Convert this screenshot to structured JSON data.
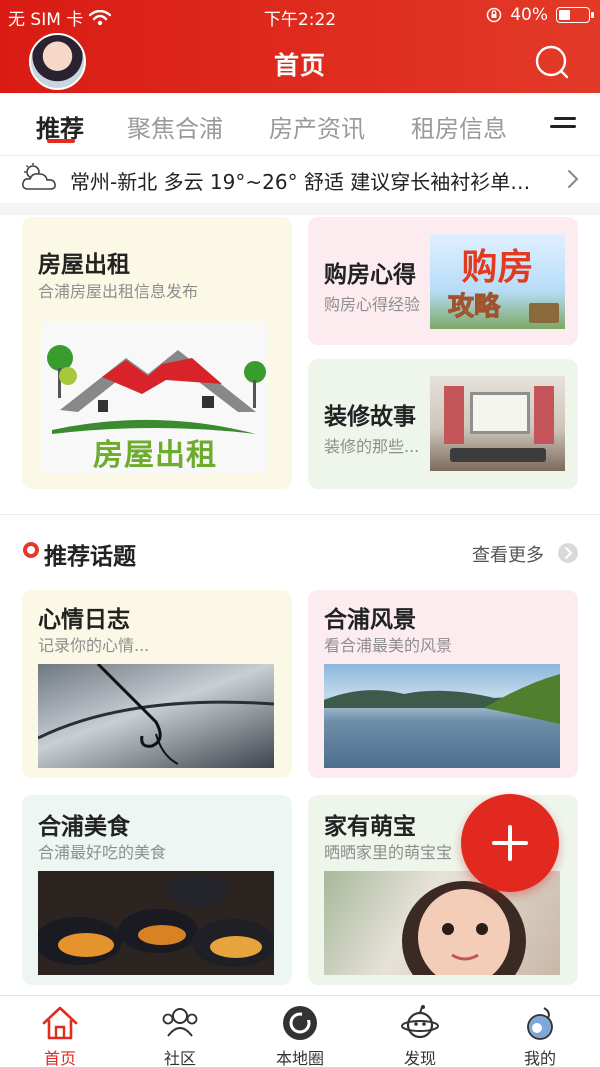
{
  "status_bar": {
    "carrier": "无 SIM 卡",
    "time": "下午2:22",
    "battery": "40%",
    "battery_level": 0.4
  },
  "header": {
    "title": "首页",
    "avatar_icon": "user-avatar",
    "search_icon": "search-icon",
    "color": "#dd2a1e"
  },
  "tabs": [
    {
      "label": "推荐",
      "active": true
    },
    {
      "label": "聚焦合浦",
      "active": false
    },
    {
      "label": "房产资讯",
      "active": false
    },
    {
      "label": "租房信息",
      "active": false
    }
  ],
  "weather": {
    "icon": "cloudy-icon",
    "text": "常州-新北 多云 19°~26° 舒适 建议穿长袖衬衫单…"
  },
  "feature_cards": {
    "rental": {
      "title": "房屋出租",
      "subtitle": "合浦房屋出租信息发布",
      "image_text": "房屋出租"
    },
    "buy": {
      "title": "购房心得",
      "subtitle": "购房心得经验",
      "image_text_1": "购房",
      "image_text_2": "攻略"
    },
    "decoration": {
      "title": "装修故事",
      "subtitle": "装修的那些..."
    }
  },
  "recommended_topics": {
    "title": "推荐话题",
    "more_label": "查看更多",
    "items": [
      {
        "title": "心情日志",
        "subtitle": "记录你的心情..."
      },
      {
        "title": "合浦风景",
        "subtitle": "看合浦最美的风景"
      },
      {
        "title": "合浦美食",
        "subtitle": "合浦最好吃的美食"
      },
      {
        "title": "家有萌宝",
        "subtitle": "晒晒家里的萌宝宝"
      }
    ]
  },
  "fab": {
    "icon": "plus-icon"
  },
  "bottom_nav": [
    {
      "label": "首页",
      "icon": "home-icon",
      "active": true
    },
    {
      "label": "社区",
      "icon": "community-icon",
      "active": false
    },
    {
      "label": "本地圈",
      "icon": "local-circle-icon",
      "active": false
    },
    {
      "label": "发现",
      "icon": "discover-icon",
      "active": false
    },
    {
      "label": "我的",
      "icon": "profile-icon",
      "active": false
    }
  ],
  "colors": {
    "accent": "#e02b1d",
    "inactive_tab": "#9a9a9a"
  }
}
